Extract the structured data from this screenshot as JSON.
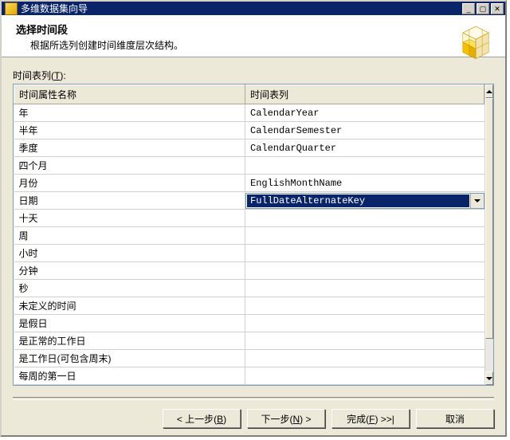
{
  "titlebar": {
    "title": "多维数据集向导"
  },
  "header": {
    "title": "选择时间段",
    "subtitle": "根据所选列创建时间维度层次结构。"
  },
  "list_label_prefix": "时间表列(",
  "list_label_hotkey": "T",
  "list_label_suffix": "):",
  "columns": {
    "name": "时间属性名称",
    "table": "时间表列"
  },
  "rows": [
    {
      "name": "年",
      "value": "CalendarYear"
    },
    {
      "name": "半年",
      "value": "CalendarSemester"
    },
    {
      "name": "季度",
      "value": "CalendarQuarter"
    },
    {
      "name": "四个月",
      "value": ""
    },
    {
      "name": "月份",
      "value": "EnglishMonthName"
    },
    {
      "name": "日期",
      "value": "FullDateAlternateKey",
      "selected": true
    },
    {
      "name": "十天",
      "value": ""
    },
    {
      "name": "周",
      "value": ""
    },
    {
      "name": "小时",
      "value": ""
    },
    {
      "name": "分钟",
      "value": ""
    },
    {
      "name": "秒",
      "value": ""
    },
    {
      "name": "未定义的时间",
      "value": ""
    },
    {
      "name": "是假日",
      "value": ""
    },
    {
      "name": "是正常的工作日",
      "value": ""
    },
    {
      "name": "是工作日(可包含周末)",
      "value": ""
    },
    {
      "name": "每周的第一日",
      "value": ""
    }
  ],
  "buttons": {
    "back_prefix": "< 上一步(",
    "back_hotkey": "B",
    "back_suffix": ")",
    "next_prefix": "下一步(",
    "next_hotkey": "N",
    "next_suffix": ") >",
    "finish_prefix": "完成(",
    "finish_hotkey": "F",
    "finish_suffix": ") >>|",
    "cancel": "取消"
  }
}
